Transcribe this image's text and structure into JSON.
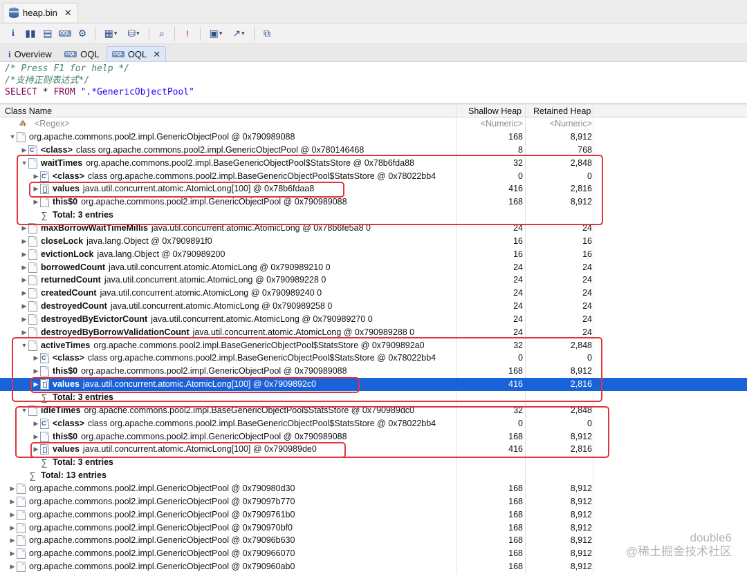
{
  "window": {
    "file_tab": "heap.bin"
  },
  "toolbar": {
    "icons": [
      "info-icon",
      "histogram-icon",
      "dominator-tree-icon",
      "oql-icon",
      "heap-dump-overview-icon",
      "query-browser-icon",
      "reports-icon",
      "search-icon",
      "stop-icon",
      "layout-icon",
      "export-icon",
      "copy-icon"
    ]
  },
  "tabs": [
    {
      "label": "Overview"
    },
    {
      "label": "OQL"
    },
    {
      "label": "OQL"
    }
  ],
  "editor": {
    "line1": "/* Press F1 for help */",
    "line2": "/*支持正则表达式*/",
    "kw_select": "SELECT",
    "star": "*",
    "kw_from": "FROM",
    "pattern": "\".*GenericObjectPool\""
  },
  "columns": {
    "class_name": "Class Name",
    "shallow": "Shallow Heap",
    "retained": "Retained Heap"
  },
  "filter_row": {
    "regex": "<Regex>",
    "numeric1": "<Numeric>",
    "numeric2": "<Numeric>"
  },
  "rows": [
    {
      "indent": 1,
      "twisty": "▼",
      "icon": "file",
      "name": "",
      "rest": "org.apache.commons.pool2.impl.GenericObjectPool @ 0x790989088",
      "sh": "168",
      "rh": "8,912"
    },
    {
      "indent": 2,
      "twisty": "▶",
      "icon": "cls",
      "name": "<class>",
      "rest": "class org.apache.commons.pool2.impl.GenericObjectPool @ 0x780146468",
      "sh": "8",
      "rh": "768"
    },
    {
      "indent": 2,
      "twisty": "▼",
      "icon": "file",
      "name": "waitTimes",
      "rest": "org.apache.commons.pool2.impl.BaseGenericObjectPool$StatsStore @ 0x78b6fda88",
      "sh": "32",
      "rh": "2,848"
    },
    {
      "indent": 3,
      "twisty": "▶",
      "icon": "cls",
      "name": "<class>",
      "rest": "class org.apache.commons.pool2.impl.BaseGenericObjectPool$StatsStore @ 0x78022bb4",
      "sh": "0",
      "rh": "0"
    },
    {
      "indent": 3,
      "twisty": "▶",
      "icon": "arr",
      "name": "values",
      "rest": "java.util.concurrent.atomic.AtomicLong[100] @ 0x78b6fdaa8",
      "sh": "416",
      "rh": "2,816"
    },
    {
      "indent": 3,
      "twisty": "▶",
      "icon": "file",
      "name": "this$0",
      "rest": "org.apache.commons.pool2.impl.GenericObjectPool @ 0x790989088",
      "sh": "168",
      "rh": "8,912"
    },
    {
      "indent": 3,
      "twisty": "",
      "icon": "sigma",
      "name": "Total: 3 entries",
      "rest": "",
      "sh": "",
      "rh": ""
    },
    {
      "indent": 2,
      "twisty": "▶",
      "icon": "file",
      "name": "maxBorrowWaitTimeMillis",
      "rest": "java.util.concurrent.atomic.AtomicLong @ 0x78b6fe5a8  0",
      "sh": "24",
      "rh": "24"
    },
    {
      "indent": 2,
      "twisty": "▶",
      "icon": "file",
      "name": "closeLock",
      "rest": "java.lang.Object @ 0x7909891f0",
      "sh": "16",
      "rh": "16"
    },
    {
      "indent": 2,
      "twisty": "▶",
      "icon": "file",
      "name": "evictionLock",
      "rest": "java.lang.Object @ 0x790989200",
      "sh": "16",
      "rh": "16"
    },
    {
      "indent": 2,
      "twisty": "▶",
      "icon": "file",
      "name": "borrowedCount",
      "rest": "java.util.concurrent.atomic.AtomicLong @ 0x790989210  0",
      "sh": "24",
      "rh": "24"
    },
    {
      "indent": 2,
      "twisty": "▶",
      "icon": "file",
      "name": "returnedCount",
      "rest": "java.util.concurrent.atomic.AtomicLong @ 0x790989228  0",
      "sh": "24",
      "rh": "24"
    },
    {
      "indent": 2,
      "twisty": "▶",
      "icon": "file",
      "name": "createdCount",
      "rest": "java.util.concurrent.atomic.AtomicLong @ 0x790989240  0",
      "sh": "24",
      "rh": "24"
    },
    {
      "indent": 2,
      "twisty": "▶",
      "icon": "file",
      "name": "destroyedCount",
      "rest": "java.util.concurrent.atomic.AtomicLong @ 0x790989258  0",
      "sh": "24",
      "rh": "24"
    },
    {
      "indent": 2,
      "twisty": "▶",
      "icon": "file",
      "name": "destroyedByEvictorCount",
      "rest": "java.util.concurrent.atomic.AtomicLong @ 0x790989270  0",
      "sh": "24",
      "rh": "24"
    },
    {
      "indent": 2,
      "twisty": "▶",
      "icon": "file",
      "name": "destroyedByBorrowValidationCount",
      "rest": "java.util.concurrent.atomic.AtomicLong @ 0x790989288  0",
      "sh": "24",
      "rh": "24"
    },
    {
      "indent": 2,
      "twisty": "▼",
      "icon": "file",
      "name": "activeTimes",
      "rest": "org.apache.commons.pool2.impl.BaseGenericObjectPool$StatsStore @ 0x7909892a0",
      "sh": "32",
      "rh": "2,848"
    },
    {
      "indent": 3,
      "twisty": "▶",
      "icon": "cls",
      "name": "<class>",
      "rest": "class org.apache.commons.pool2.impl.BaseGenericObjectPool$StatsStore @ 0x78022bb4",
      "sh": "0",
      "rh": "0"
    },
    {
      "indent": 3,
      "twisty": "▶",
      "icon": "file",
      "name": "this$0",
      "rest": "org.apache.commons.pool2.impl.GenericObjectPool @ 0x790989088",
      "sh": "168",
      "rh": "8,912"
    },
    {
      "indent": 3,
      "twisty": "▶",
      "icon": "arr",
      "name": "values",
      "rest": "java.util.concurrent.atomic.AtomicLong[100] @ 0x7909892c0",
      "sh": "416",
      "rh": "2,816",
      "selected": true
    },
    {
      "indent": 3,
      "twisty": "",
      "icon": "sigma",
      "name": "Total: 3 entries",
      "rest": "",
      "sh": "",
      "rh": ""
    },
    {
      "indent": 2,
      "twisty": "▼",
      "icon": "file",
      "name": "idleTimes",
      "rest": "org.apache.commons.pool2.impl.BaseGenericObjectPool$StatsStore @ 0x790989dc0",
      "sh": "32",
      "rh": "2,848"
    },
    {
      "indent": 3,
      "twisty": "▶",
      "icon": "cls",
      "name": "<class>",
      "rest": "class org.apache.commons.pool2.impl.BaseGenericObjectPool$StatsStore @ 0x78022bb4",
      "sh": "0",
      "rh": "0"
    },
    {
      "indent": 3,
      "twisty": "▶",
      "icon": "file",
      "name": "this$0",
      "rest": "org.apache.commons.pool2.impl.GenericObjectPool @ 0x790989088",
      "sh": "168",
      "rh": "8,912"
    },
    {
      "indent": 3,
      "twisty": "▶",
      "icon": "arr",
      "name": "values",
      "rest": "java.util.concurrent.atomic.AtomicLong[100] @ 0x790989de0",
      "sh": "416",
      "rh": "2,816"
    },
    {
      "indent": 3,
      "twisty": "",
      "icon": "sigma",
      "name": "Total: 3 entries",
      "rest": "",
      "sh": "",
      "rh": ""
    },
    {
      "indent": 2,
      "twisty": "",
      "icon": "sigma",
      "name": "Total: 13 entries",
      "rest": "",
      "sh": "",
      "rh": ""
    },
    {
      "indent": 1,
      "twisty": "▶",
      "icon": "file",
      "name": "",
      "rest": "org.apache.commons.pool2.impl.GenericObjectPool @ 0x790980d30",
      "sh": "168",
      "rh": "8,912"
    },
    {
      "indent": 1,
      "twisty": "▶",
      "icon": "file",
      "name": "",
      "rest": "org.apache.commons.pool2.impl.GenericObjectPool @ 0x79097b770",
      "sh": "168",
      "rh": "8,912"
    },
    {
      "indent": 1,
      "twisty": "▶",
      "icon": "file",
      "name": "",
      "rest": "org.apache.commons.pool2.impl.GenericObjectPool @ 0x7909761b0",
      "sh": "168",
      "rh": "8,912"
    },
    {
      "indent": 1,
      "twisty": "▶",
      "icon": "file",
      "name": "",
      "rest": "org.apache.commons.pool2.impl.GenericObjectPool @ 0x790970bf0",
      "sh": "168",
      "rh": "8,912"
    },
    {
      "indent": 1,
      "twisty": "▶",
      "icon": "file",
      "name": "",
      "rest": "org.apache.commons.pool2.impl.GenericObjectPool @ 0x79096b630",
      "sh": "168",
      "rh": "8,912"
    },
    {
      "indent": 1,
      "twisty": "▶",
      "icon": "file",
      "name": "",
      "rest": "org.apache.commons.pool2.impl.GenericObjectPool @ 0x790966070",
      "sh": "168",
      "rh": "8,912"
    },
    {
      "indent": 1,
      "twisty": "▶",
      "icon": "file",
      "name": "",
      "rest": "org.apache.commons.pool2.impl.GenericObjectPool @ 0x790960ab0",
      "sh": "168",
      "rh": "8,912"
    }
  ],
  "watermark": {
    "line1": "double6",
    "line2": "@稀土掘金技术社区"
  },
  "colors": {
    "selection": "#1963d8",
    "highlight_border": "#e0353d",
    "comment": "#3f7f5f",
    "keyword": "#7f0055",
    "string": "#2a00ff"
  }
}
